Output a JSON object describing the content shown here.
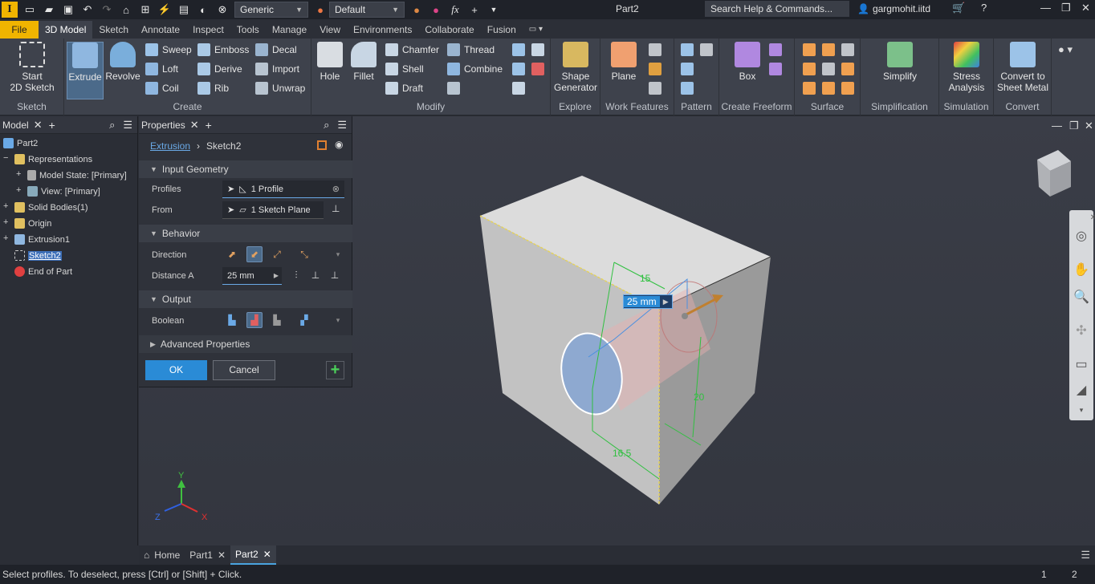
{
  "titlebar": {
    "app_letter": "I",
    "material": "Generic",
    "appearance": "Default",
    "fx": "fx",
    "doc_title": "Part2",
    "search_placeholder": "Search Help & Commands...",
    "user": "gargmohit.iitd"
  },
  "ribbon_tabs": [
    "File",
    "3D Model",
    "Sketch",
    "Annotate",
    "Inspect",
    "Tools",
    "Manage",
    "View",
    "Environments",
    "Collaborate",
    "Fusion"
  ],
  "active_tab": "3D Model",
  "ribbon": {
    "sketch": {
      "label": "Sketch",
      "start_line1": "Start",
      "start_line2": "2D Sketch"
    },
    "create": {
      "label": "Create",
      "extrude": "Extrude",
      "revolve": "Revolve",
      "sweep": "Sweep",
      "emboss": "Emboss",
      "decal": "Decal",
      "loft": "Loft",
      "derive": "Derive",
      "import": "Import",
      "coil": "Coil",
      "rib": "Rib",
      "unwrap": "Unwrap"
    },
    "modify": {
      "label": "Modify",
      "hole": "Hole",
      "fillet": "Fillet",
      "chamfer": "Chamfer",
      "thread": "Thread",
      "shell": "Shell",
      "combine": "Combine",
      "draft": "Draft"
    },
    "explore": {
      "label": "Explore",
      "line1": "Shape",
      "line2": "Generator"
    },
    "work": {
      "label": "Work Features",
      "plane": "Plane"
    },
    "pattern": {
      "label": "Pattern"
    },
    "freeform": {
      "label": "Create Freeform",
      "box": "Box"
    },
    "surface": {
      "label": "Surface"
    },
    "simplification": {
      "label": "Simplification",
      "simplify": "Simplify"
    },
    "simulation": {
      "label": "Simulation",
      "line1": "Stress",
      "line2": "Analysis"
    },
    "convert": {
      "label": "Convert",
      "line1": "Convert to",
      "line2": "Sheet Metal"
    }
  },
  "browser": {
    "title": "Model",
    "items": [
      {
        "label": "Part2"
      },
      {
        "label": "Representations"
      },
      {
        "label": "Model State: [Primary]"
      },
      {
        "label": "View: [Primary]"
      },
      {
        "label": "Solid Bodies(1)"
      },
      {
        "label": "Origin"
      },
      {
        "label": "Extrusion1"
      },
      {
        "label": "Sketch2"
      },
      {
        "label": "End of Part"
      }
    ]
  },
  "properties": {
    "title": "Properties",
    "crumb_link": "Extrusion",
    "crumb_current": "Sketch2",
    "input_geometry": "Input Geometry",
    "profiles_label": "Profiles",
    "profiles_value": "1 Profile",
    "from_label": "From",
    "from_value": "1 Sketch Plane",
    "behavior": "Behavior",
    "direction_label": "Direction",
    "distance_label": "Distance A",
    "distance_value": "25 mm",
    "output": "Output",
    "boolean_label": "Boolean",
    "advanced": "Advanced Properties",
    "ok": "OK",
    "cancel": "Cancel"
  },
  "viewport": {
    "dim_15": "15",
    "dim_20": "20",
    "dim_16_5": "16.5",
    "distance_badge": "25 mm",
    "axis_x": "X",
    "axis_y": "Y",
    "axis_z": "Z"
  },
  "doc_tabs": [
    "Home",
    "Part1",
    "Part2"
  ],
  "status": {
    "message": "Select profiles. To deselect, press [Ctrl] or [Shift] + Click.",
    "num1": "1",
    "num2": "2"
  },
  "colors": {
    "accent": "#2a8bd6",
    "file_tab": "#f0b400",
    "ribbon_bg": "#3e424c"
  }
}
